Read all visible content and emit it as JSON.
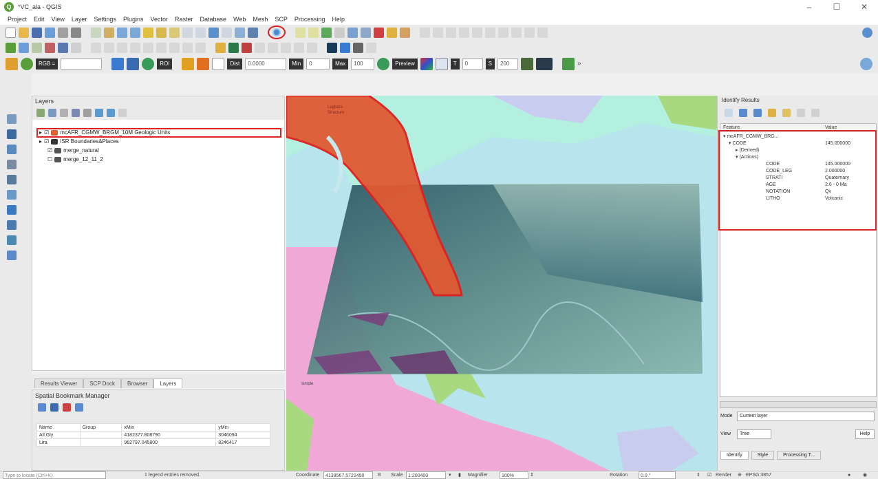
{
  "window": {
    "title": "*VC_ala - QGIS",
    "minimize": "–",
    "maximize": "☐",
    "close": "✕"
  },
  "menu": [
    "Project",
    "Edit",
    "View",
    "Layer",
    "Settings",
    "Plugins",
    "Vector",
    "Raster",
    "Database",
    "Web",
    "Mesh",
    "SCP",
    "Processing",
    "Help"
  ],
  "toolbar3": {
    "field_a": "RGB =",
    "value_1": "0.0000",
    "label_2": "Min",
    "value_2": "0",
    "label_3": "Max",
    "value_3": "100",
    "preview": "Preview",
    "value_4": "0",
    "value_5": "200"
  },
  "layers_panel": {
    "title": "Layers",
    "layers": [
      {
        "name": "mcAFR_CGMW_BRGM_10M Geologic Units",
        "checked": true
      },
      {
        "name": "ISR Boundaries&Places",
        "checked": true
      },
      {
        "name": "merge_natural",
        "checked": true
      },
      {
        "name": "merge_12_11_2",
        "checked": false
      }
    ]
  },
  "panel_tabs": [
    "Results Viewer",
    "SCP Dock",
    "Browser",
    "Layers"
  ],
  "spatial_bookmarks": {
    "title": "Spatial Bookmark Manager",
    "columns": [
      "Name",
      "Group",
      "xMin",
      "yMin"
    ],
    "rows": [
      {
        "name": "All Gly",
        "group": "",
        "xmin": "4182377.808790",
        "ymin": "3046094"
      },
      {
        "name": "Lira",
        "group": "",
        "xmin": "962797.045800",
        "ymin": "8246417"
      }
    ]
  },
  "map": {
    "labels": {
      "top_label": "Lugbara\nStructure",
      "bottom_label": "simple"
    },
    "colors": {
      "water": "#b8e4ee",
      "geology_red": "#e05a32",
      "outline": "#e02020",
      "pink": "#f0a8d6",
      "green": "#a8d880",
      "aqua": "#b4f0e0",
      "lavender": "#c8ccee"
    }
  },
  "identify": {
    "title": "Identify Results",
    "headers": {
      "feature": "Feature",
      "value": "Value"
    },
    "rows": [
      {
        "feature": "▾ mcAFR_CGMW_BRG...",
        "value": ""
      },
      {
        "feature": "▾ CODE",
        "value": "145.000000"
      },
      {
        "feature": "▸ (Derived)",
        "value": ""
      },
      {
        "feature": "▾ (Actions)",
        "value": ""
      },
      {
        "feature": "CODE",
        "value": "145.000000"
      },
      {
        "feature": "CODE_LEG",
        "value": "2.000000"
      },
      {
        "feature": "STRATI",
        "value": "Quaternary"
      },
      {
        "feature": "AGE",
        "value": "2.6 - 0 Ma"
      },
      {
        "feature": "NOTATION",
        "value": "Qv"
      },
      {
        "feature": "LITHO",
        "value": "Volcanic"
      }
    ],
    "mode_label": "Mode",
    "mode_value": "Current layer",
    "view_label": "View",
    "view_value": "Tree",
    "help": "Help",
    "tabs": [
      "Identify",
      "Style",
      "Processing T..."
    ]
  },
  "statusbar": {
    "search_placeholder": "Type to locate (Ctrl+K)",
    "message": "1 legend entries removed.",
    "coordinate_label": "Coordinate",
    "coordinate_value": "4139567,5722450",
    "scale_label": "Scale",
    "scale_value": "1:200400",
    "magnifier_label": "Magnifier",
    "magnifier_value": "100%",
    "rotation_label": "Rotation",
    "rotation_value": "0.0 °",
    "render_label": "Render",
    "crs": "EPSG:3857"
  }
}
